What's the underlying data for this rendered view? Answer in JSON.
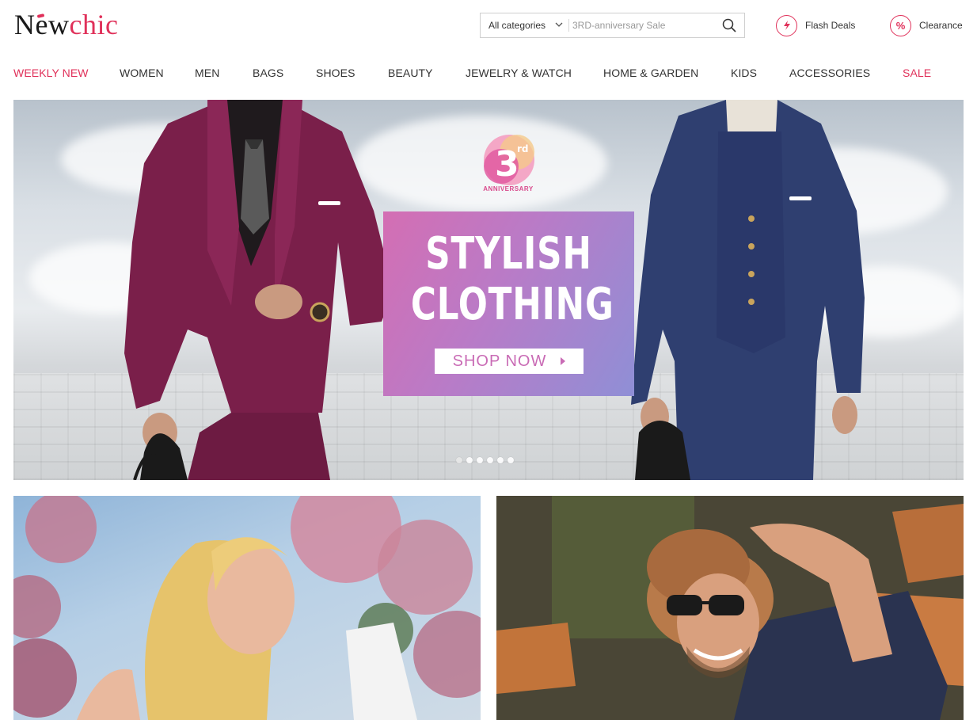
{
  "header": {
    "logo": {
      "part1": "N",
      "part2": "ew",
      "part3": "chic"
    },
    "search": {
      "category_selected": "All categories",
      "placeholder": "3RD-anniversary Sale"
    },
    "links": [
      {
        "label": "Flash Deals",
        "icon": "lightning-icon"
      },
      {
        "label": "Clearance",
        "icon": "percent-icon",
        "glyph": "%"
      }
    ]
  },
  "nav": {
    "items": [
      {
        "label": "WEEKLY NEW",
        "highlight": true
      },
      {
        "label": "WOMEN",
        "highlight": false
      },
      {
        "label": "MEN",
        "highlight": false
      },
      {
        "label": "BAGS",
        "highlight": false
      },
      {
        "label": "SHOES",
        "highlight": false
      },
      {
        "label": "BEAUTY",
        "highlight": false
      },
      {
        "label": "JEWELRY & WATCH",
        "highlight": false
      },
      {
        "label": "HOME & GARDEN",
        "highlight": false
      },
      {
        "label": "KIDS",
        "highlight": false
      },
      {
        "label": "ACCESSORIES",
        "highlight": false
      },
      {
        "label": "SALE",
        "highlight": true
      }
    ]
  },
  "banner": {
    "badge_number": "3",
    "badge_suffix": "rd",
    "badge_text": "ANNIVERSARY",
    "title_line1": "STYLISH",
    "title_line2": "CLOTHING",
    "cta": "SHOP NOW",
    "carousel_count": 6,
    "carousel_active": 1
  },
  "colors": {
    "brand": "#e0315a",
    "promo_start": "#d46eb3",
    "promo_end": "#8f8fd6",
    "suit_left": "#7a1f4a",
    "suit_right": "#2f3f70"
  }
}
